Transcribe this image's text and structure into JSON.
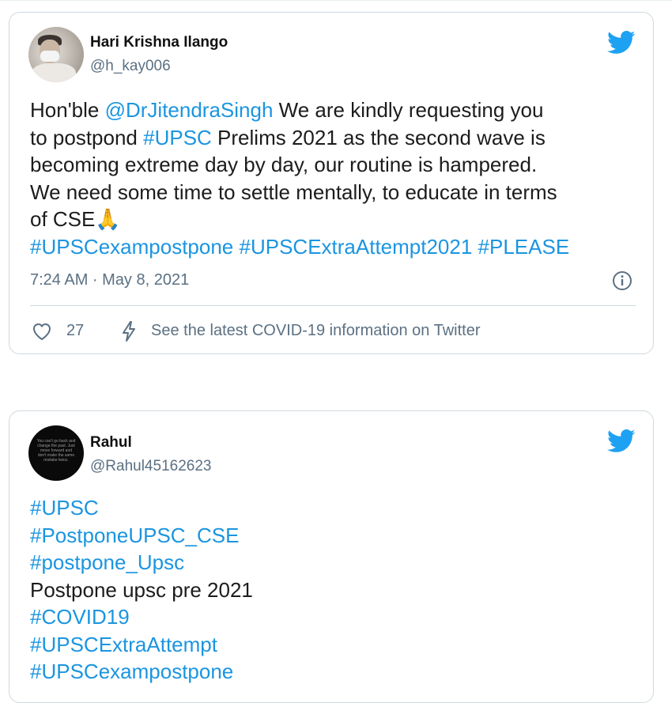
{
  "tweets": [
    {
      "author": {
        "name": "Hari Krishna Ilango",
        "handle": "@h_kay006"
      },
      "body_lines": [
        [
          {
            "t": "Hon'ble "
          },
          {
            "t": "@DrJitendraSingh",
            "link": true
          },
          {
            "t": "  We are kindly requesting you"
          }
        ],
        [
          {
            "t": "to postpond "
          },
          {
            "t": "#UPSC",
            "link": true
          },
          {
            "t": " Prelims 2021 as the second wave is"
          }
        ],
        [
          {
            "t": "becoming extreme day by day, our routine is hampered."
          }
        ],
        [
          {
            "t": "We need some time to settle mentally, to educate in terms"
          }
        ],
        [
          {
            "t": "of CSE🙏"
          }
        ],
        [
          {
            "t": "#UPSCexampostpone",
            "link": true
          },
          {
            "t": " "
          },
          {
            "t": "#UPSCExtraAttempt2021",
            "link": true
          },
          {
            "t": " "
          },
          {
            "t": "#PLEASE",
            "link": true
          }
        ]
      ],
      "timestamp": "7:24 AM · May 8, 2021",
      "likes": "27",
      "covid_notice": "See the latest COVID-19 information on Twitter"
    },
    {
      "author": {
        "name": "Rahul",
        "handle": "@Rahul45162623"
      },
      "avatar_text": "You can't go back and change the past. Just move forward and don't make the same mistake twice.",
      "body_lines": [
        [
          {
            "t": "#UPSC",
            "link": true
          }
        ],
        [
          {
            "t": "#PostponeUPSC_CSE",
            "link": true
          }
        ],
        [
          {
            "t": "#postpone_Upsc",
            "link": true
          }
        ],
        [
          {
            "t": "Postpone upsc pre 2021"
          }
        ],
        [
          {
            "t": "#COVID19",
            "link": true
          }
        ],
        [
          {
            "t": "#UPSCExtraAttempt",
            "link": true
          }
        ],
        [
          {
            "t": "#UPSCexampostpone",
            "link": true
          }
        ]
      ]
    }
  ],
  "icons": {
    "brand": "twitter-bird-icon",
    "info": "info-icon",
    "like": "heart-icon",
    "covid": "lightning-bolt-icon"
  },
  "colors": {
    "link": "#1b95e0",
    "twitter_blue": "#1da1f2",
    "secondary_text": "#5b7083",
    "border": "#cfd9de"
  }
}
